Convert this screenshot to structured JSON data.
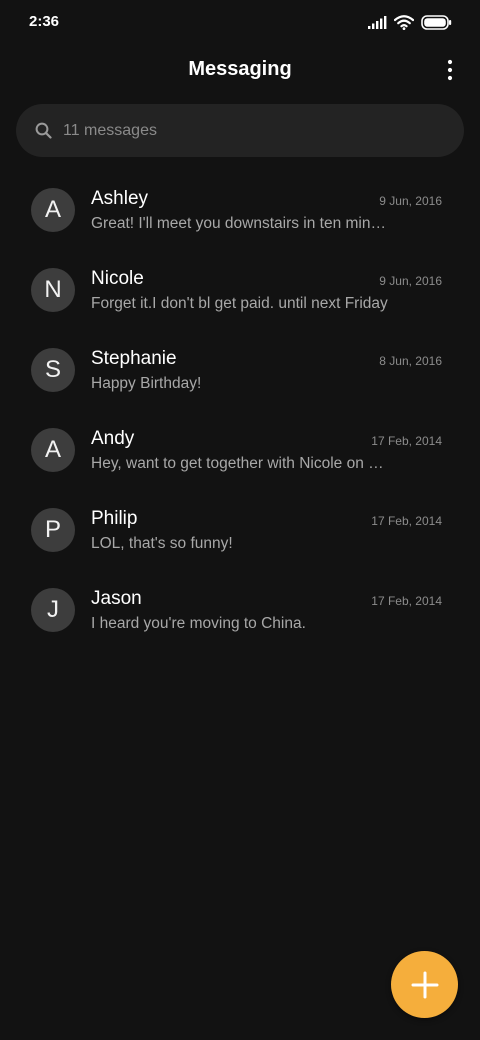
{
  "status_bar": {
    "time": "2:36",
    "icons": [
      "signal-icon",
      "wifi-icon",
      "battery-icon"
    ]
  },
  "header": {
    "title": "Messaging",
    "menu_icon": "more-vertical-icon"
  },
  "search": {
    "placeholder": "11 messages",
    "value": "",
    "icon": "search-icon"
  },
  "conversations": [
    {
      "initial": "A",
      "name": "Ashley",
      "date": "9 Jun, 2016",
      "preview": "Great! I'll meet you downstairs in ten minutes"
    },
    {
      "initial": "N",
      "name": "Nicole",
      "date": "9 Jun, 2016",
      "preview": "Forget it.I don't bl get paid. until next Friday"
    },
    {
      "initial": "S",
      "name": "Stephanie",
      "date": "8 Jun, 2016",
      "preview": "Happy Birthday!"
    },
    {
      "initial": "A",
      "name": "Andy",
      "date": "17 Feb, 2014",
      "preview": "Hey, want to get together with Nicole on Saturday?"
    },
    {
      "initial": "P",
      "name": "Philip",
      "date": "17 Feb, 2014",
      "preview": "LOL, that's so funny!"
    },
    {
      "initial": "J",
      "name": "Jason",
      "date": "17 Feb, 2014",
      "preview": "I heard you're moving to China."
    }
  ],
  "fab": {
    "icon": "plus-icon",
    "color": "#f5ae3c"
  },
  "colors": {
    "background": "#121212",
    "search_background": "#232323",
    "avatar_background": "#3d3d3d",
    "accent": "#f5ae3c"
  }
}
